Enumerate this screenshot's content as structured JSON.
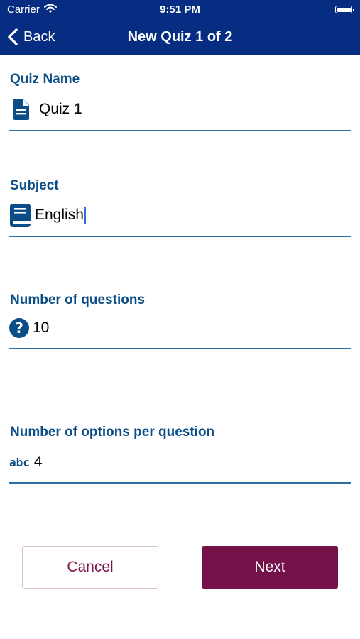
{
  "status_bar": {
    "carrier": "Carrier",
    "time": "9:51 PM"
  },
  "nav": {
    "back_label": "Back",
    "title": "New Quiz 1 of 2"
  },
  "form": {
    "quiz_name": {
      "label": "Quiz Name",
      "value": "Quiz 1",
      "icon": "document-icon"
    },
    "subject": {
      "label": "Subject",
      "value": "English",
      "icon": "book-icon"
    },
    "num_questions": {
      "label": "Number of questions",
      "value": "10",
      "icon": "question-circle-icon"
    },
    "num_options": {
      "label": "Number of options per question",
      "value": "4",
      "icon": "abc-icon",
      "icon_text": "abc"
    }
  },
  "actions": {
    "cancel_label": "Cancel",
    "next_label": "Next"
  },
  "colors": {
    "header_bg": "#062d82",
    "label": "#0b4d86",
    "accent": "#75124a",
    "underline": "#2e6da4"
  }
}
